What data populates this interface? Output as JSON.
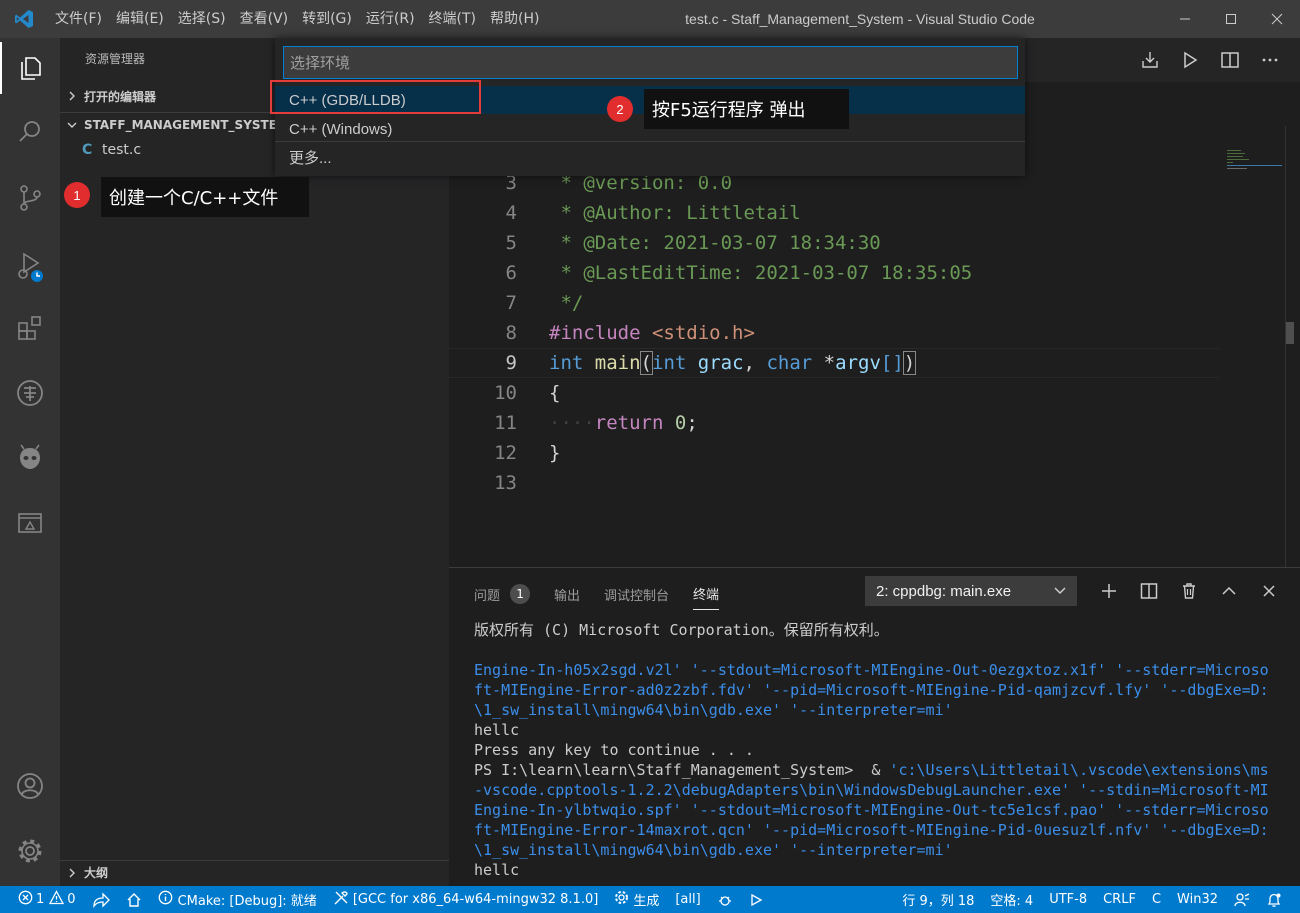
{
  "window": {
    "title": "test.c - Staff_Management_System - Visual Studio Code",
    "menu": [
      "文件(F)",
      "编辑(E)",
      "选择(S)",
      "查看(V)",
      "转到(G)",
      "运行(R)",
      "终端(T)",
      "帮助(H)"
    ]
  },
  "sidebar": {
    "title": "资源管理器",
    "open_editors": "打开的编辑器",
    "folder": "STAFF_MANAGEMENT_SYSTEM",
    "file_icon": "C",
    "file": "test.c",
    "outline": "大纲"
  },
  "quickpick": {
    "placeholder": "选择环境",
    "items": [
      "C++ (GDB/LLDB)",
      "C++ (Windows)",
      "更多..."
    ]
  },
  "annotations": {
    "one_num": "1",
    "one_text": "创建一个C/C++文件",
    "two_num": "2",
    "two_text": "按F5运行程序 弹出"
  },
  "editor": {
    "line_numbers": [
      "3",
      "4",
      "5",
      "6",
      "7",
      "8",
      "9",
      "10",
      "11",
      "12",
      "13"
    ],
    "current_line": "9"
  },
  "panel": {
    "tabs": [
      "问题",
      "输出",
      "调试控制台",
      "终端"
    ],
    "problems_count": "1",
    "active_tab": "终端",
    "terminal_select": "2: cppdbg: main.exe",
    "terminal_lines": [
      {
        "cls": "cmd",
        "text": "版权所有 (C) Microsoft Corporation。保留所有权利。"
      },
      {
        "cls": "cmd",
        "text": ""
      },
      {
        "cls": "blue",
        "text": "Engine-In-h05x2sgd.v2l' '--stdout=Microsoft-MIEngine-Out-0ezgxtoz.x1f' '--stderr=Microso"
      },
      {
        "cls": "blue",
        "text": "ft-MIEngine-Error-ad0z2zbf.fdv' '--pid=Microsoft-MIEngine-Pid-qamjzcvf.lfy' '--dbgExe=D:"
      },
      {
        "cls": "blue",
        "text": "\\1_sw_install\\mingw64\\bin\\gdb.exe' '--interpreter=mi'"
      },
      {
        "cls": "cmd",
        "text": "hellc"
      },
      {
        "cls": "cmd",
        "text": "Press any key to continue . . ."
      },
      {
        "cls": "mixed",
        "prefix": "PS I:\\learn\\learn\\Staff_Management_System>  & ",
        "text": "'c:\\Users\\Littletail\\.vscode\\extensions\\ms"
      },
      {
        "cls": "blue",
        "text": "-vscode.cpptools-1.2.2\\debugAdapters\\bin\\WindowsDebugLauncher.exe' '--stdin=Microsoft-MI"
      },
      {
        "cls": "blue",
        "text": "Engine-In-ylbtwqio.spf' '--stdout=Microsoft-MIEngine-Out-tc5e1csf.pao' '--stderr=Microso"
      },
      {
        "cls": "blue",
        "text": "ft-MIEngine-Error-14maxrot.qcn' '--pid=Microsoft-MIEngine-Pid-0uesuzlf.nfv' '--dbgExe=D:"
      },
      {
        "cls": "blue",
        "text": "\\1_sw_install\\mingw64\\bin\\gdb.exe' '--interpreter=mi'"
      },
      {
        "cls": "cmd",
        "text": "hellc"
      }
    ]
  },
  "statusbar": {
    "errors": "1",
    "warnings": "0",
    "cmake": "CMake: [Debug]: 就绪",
    "kit": "[GCC for x86_64-w64-mingw32 8.1.0]",
    "build": "生成",
    "target": "[all]",
    "position": "行 9，列 18",
    "spaces": "空格: 4",
    "encoding": "UTF-8",
    "eol": "CRLF",
    "language": "C",
    "platform": "Win32"
  },
  "colors": {
    "accent": "#007acc",
    "annotation_red": "#e12d2d"
  }
}
